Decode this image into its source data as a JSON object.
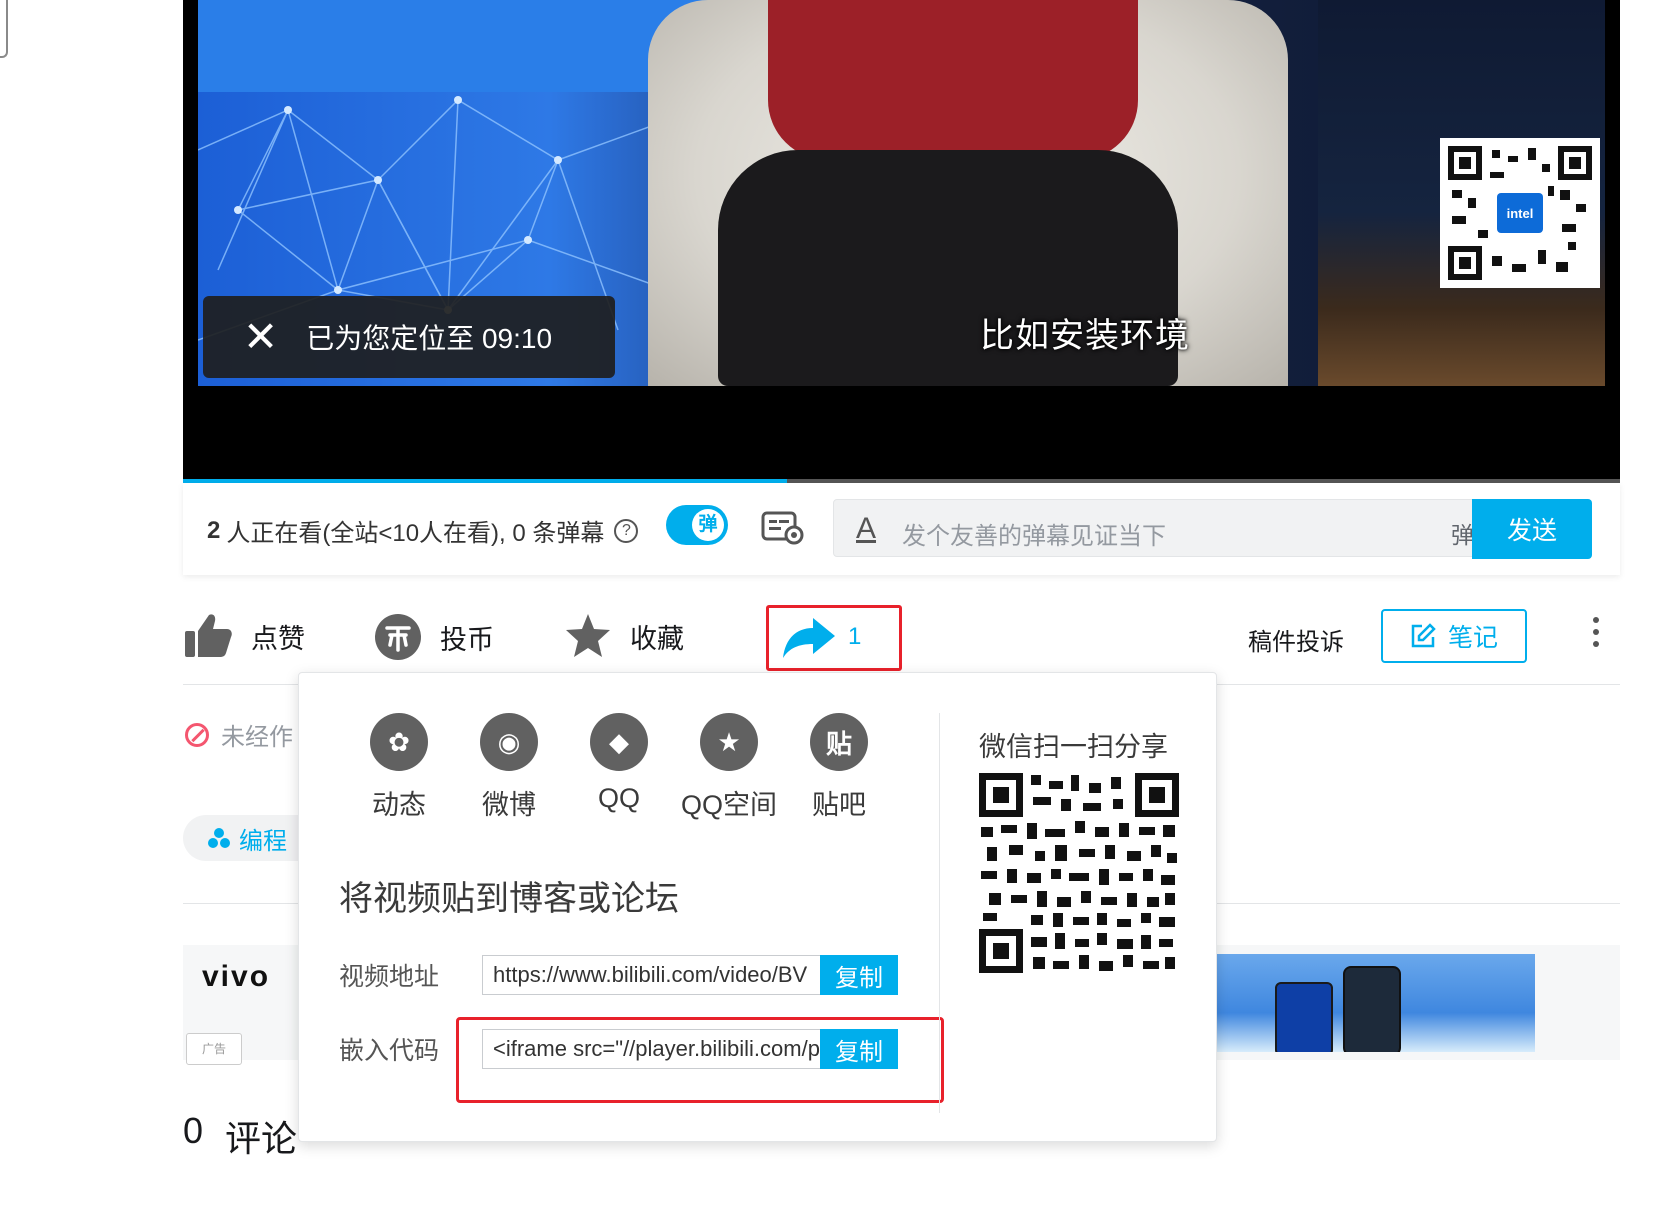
{
  "player": {
    "subtitle": "比如安装环境",
    "toast_text": "已为您定位至 09:10",
    "qr_brand": "intel",
    "progress_fraction": 0.42
  },
  "danmaku": {
    "viewers_count": "2",
    "viewers_text": "人正在看(全站<10人在看), 0 条弹幕",
    "help_icon": "?",
    "toggle_label": "弹",
    "input_placeholder": "发个友善的弹幕见证当下",
    "etiquette_label": "弹幕礼仪 ›",
    "send_label": "发送"
  },
  "actions": {
    "like_label": "点赞",
    "coin_label": "投币",
    "favorite_label": "收藏",
    "share_count": "1",
    "report_label": "稿件投诉",
    "notes_label": "笔记"
  },
  "page": {
    "no_repost_text": "未经作",
    "tag_label": "编程",
    "ad_brand": "vivo",
    "ad_mark": "广告",
    "comment_count": "0",
    "comment_label": "评论"
  },
  "share_popup": {
    "targets": [
      {
        "label": "动态",
        "glyph": "✿"
      },
      {
        "label": "微博",
        "glyph": "◉"
      },
      {
        "label": "QQ",
        "glyph": "◆"
      },
      {
        "label": "QQ空间",
        "glyph": "★"
      },
      {
        "label": "贴吧",
        "glyph": "贴"
      }
    ],
    "embed_title": "将视频贴到博客或论坛",
    "url_label": "视频地址",
    "url_value": "https://www.bilibili.com/video/BV",
    "embed_label": "嵌入代码",
    "embed_value": "<iframe src=\"//player.bilibili.com/player.html",
    "copy_label": "复制",
    "wechat_title": "微信扫一扫分享"
  },
  "colors": {
    "accent": "#00aeec",
    "highlight_red": "#e8212b",
    "icon_gray": "#616161"
  }
}
